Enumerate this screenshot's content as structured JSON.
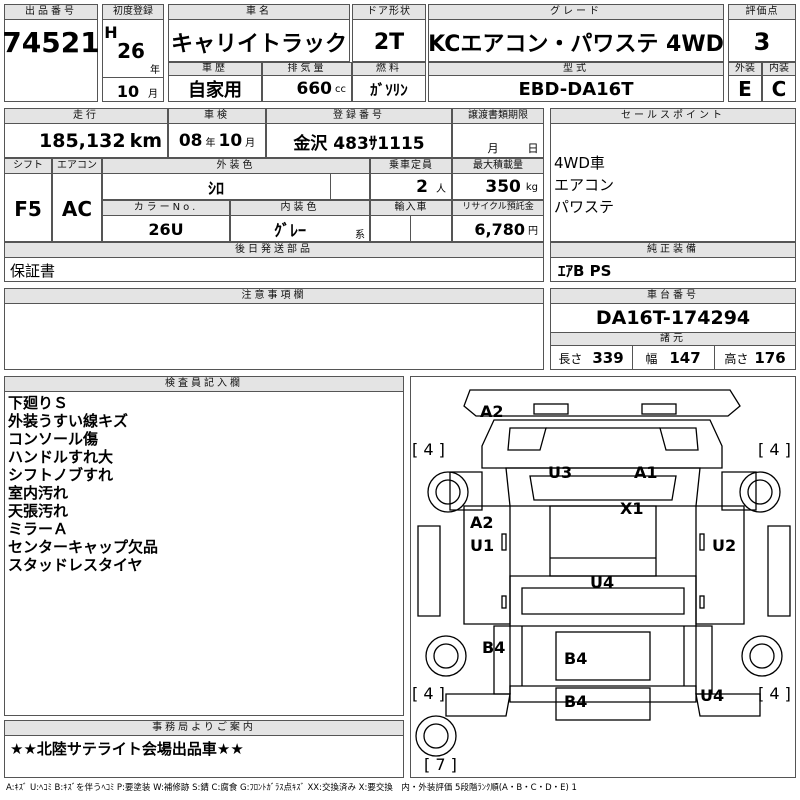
{
  "header": {
    "lot_number": {
      "label": "出品番号",
      "value": "74521"
    },
    "first_registration": {
      "label": "初度登録",
      "era": "H",
      "year": "26",
      "year_unit": "年",
      "month": "10",
      "month_unit": "月"
    },
    "car_name": {
      "label": "車名",
      "value": "キャリイトラック"
    },
    "door_type": {
      "label": "ドア形状",
      "value": "2T"
    },
    "grade": {
      "label": "グレード",
      "value": "KCエアコン・パワステ 4WD"
    },
    "score": {
      "label": "評価点",
      "value": "3"
    },
    "usage": {
      "label": "車歴",
      "value": "自家用"
    },
    "displacement": {
      "label": "排気量",
      "value": "660",
      "unit": "cc"
    },
    "fuel": {
      "label": "燃料",
      "value": "ｶﾞｿﾘﾝ"
    },
    "model_code": {
      "label": "型式",
      "value": "EBD-DA16T"
    },
    "exterior_grade": {
      "label": "外装",
      "value": "E"
    },
    "interior_grade": {
      "label": "内装",
      "value": "C"
    }
  },
  "specs": {
    "mileage": {
      "label": "走行",
      "value": "185,132",
      "unit": "km"
    },
    "inspection": {
      "label": "車検",
      "year": "08",
      "year_unit": "年",
      "month": "10",
      "month_unit": "月"
    },
    "registration_no": {
      "label": "登録番号",
      "value": "金沢 483ｻ1115"
    },
    "transfer_docs": {
      "label": "譲渡書類期限",
      "month_unit": "月",
      "day_unit": "日"
    },
    "shift": {
      "label": "シフト",
      "value": "F5"
    },
    "aircon": {
      "label": "エアコン",
      "value": "AC"
    },
    "exterior_color": {
      "label": "外装色",
      "value": "ｼﾛ"
    },
    "capacity": {
      "label": "乗車定員",
      "value": "2",
      "unit": "人"
    },
    "max_load": {
      "label": "最大積載量",
      "value": "350",
      "unit": "kg"
    },
    "color_no": {
      "label": "カラーNo.",
      "value": "26U"
    },
    "interior_color": {
      "label": "内装色",
      "value": "ｸﾞﾚｰ",
      "suffix": "系"
    },
    "import": {
      "label": "輸入車"
    },
    "recycle": {
      "label": "リサイクル預託金",
      "value": "6,780",
      "unit": "円"
    }
  },
  "sales_points": {
    "label": "セールスポイント",
    "items": [
      "4WD車",
      "エアコン",
      "パワステ"
    ]
  },
  "later_parts": {
    "label": "後日発送部品",
    "value": "保証書"
  },
  "genuine_equipment": {
    "label": "純正装備",
    "value": "ｴｱB PS"
  },
  "notes": {
    "label": "注意事項欄"
  },
  "chassis": {
    "label": "車台番号",
    "value": "DA16T-174294"
  },
  "dimensions": {
    "label": "諸元",
    "length": {
      "label": "長さ",
      "value": "339"
    },
    "width": {
      "label": "幅",
      "value": "147"
    },
    "height": {
      "label": "高さ",
      "value": "176"
    }
  },
  "inspector": {
    "label": "検査員記入欄",
    "remarks": [
      "下廻りＳ",
      "外装うすい線キズ",
      "コンソール傷",
      "ハンドルすれ大",
      "シフトノブすれ",
      "室内汚れ",
      "天張汚れ",
      "ミラーＡ",
      "センターキャップ欠品",
      "スタッドレスタイヤ"
    ]
  },
  "diagram": {
    "marks": {
      "a2_top": "A2",
      "u3": "U3",
      "a1": "A1",
      "x1": "X1",
      "a2_left": "A2",
      "u1": "U1",
      "u2": "U2",
      "u4_center": "U4",
      "b4_left": "B4",
      "b4_center": "B4",
      "b4_bottom": "B4",
      "u4_bottom": "U4"
    },
    "tires": {
      "front_left": "4",
      "front_right": "4",
      "rear_left": "4",
      "rear_right": "4",
      "spare": "7"
    }
  },
  "office_notice": {
    "label": "事務局よりご案内",
    "value": "★★北陸サテライト会場出品車★★"
  },
  "legend": "A:ｷｽﾞ U:ﾍｺﾐ B:ｷｽﾞを伴うﾍｺﾐ P:要塗装 W:補修跡 S:錆 C:腐食 G:ﾌﾛﾝﾄｶﾞﾗｽ点ｷｽﾞ XX:交換済み X:要交換　内・外装評価 5段階ﾗﾝｸ順(A・B・C・D・E) 1"
}
